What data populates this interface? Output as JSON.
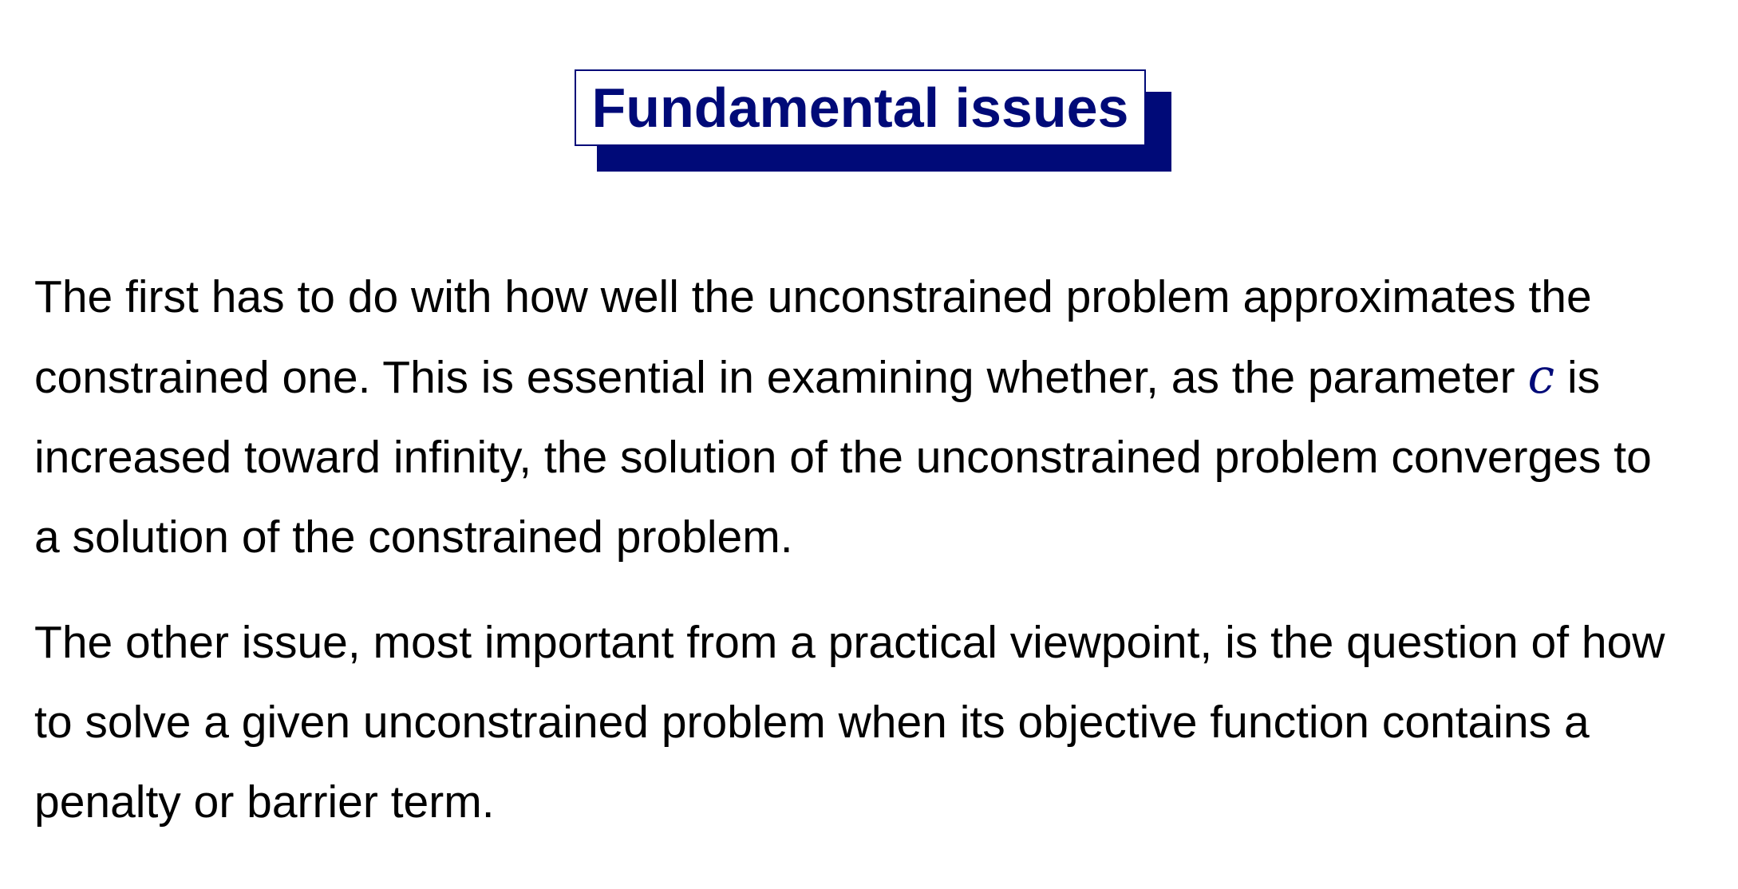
{
  "title": "Fundamental issues",
  "colors": {
    "accent": "#000a78",
    "text": "#000000",
    "background": "#ffffff"
  },
  "paragraphs": [
    {
      "lines": [
        "The first has to do with how well the unconstrained problem approximates the",
        "constrained one. This is essential in examining whether, as the parameter",
        "increased toward infinity, the solution of the unconstrained problem converges to",
        "a solution of the constrained problem."
      ],
      "variable": "c",
      "after_variable": "is"
    },
    {
      "lines": [
        "The other issue, most important from a practical viewpoint, is the question of how",
        "to solve a given unconstrained problem when its objective function contains a",
        "penalty or barrier term."
      ]
    }
  ]
}
